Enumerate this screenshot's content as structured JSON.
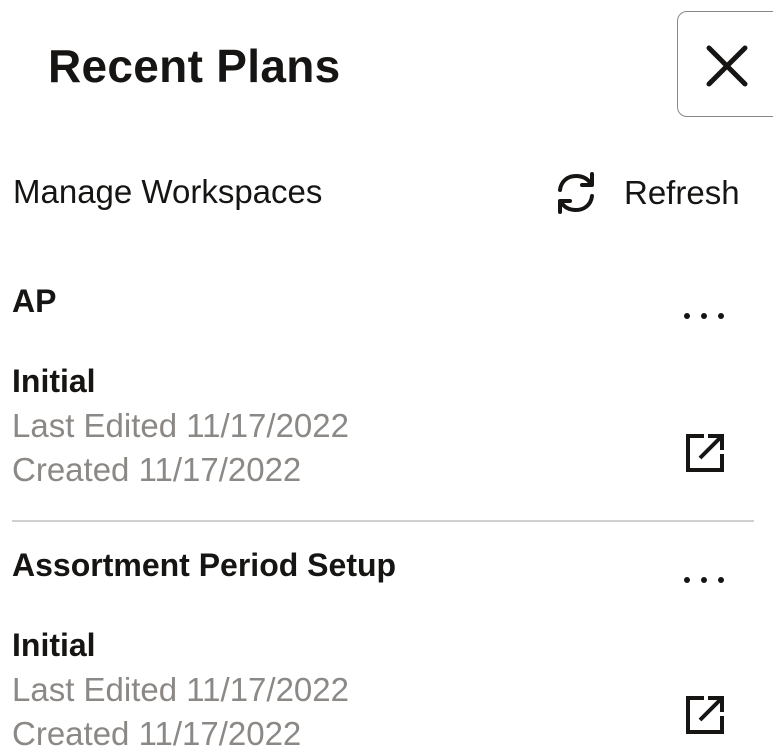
{
  "panel": {
    "title": "Recent Plans",
    "close_icon": "close-icon"
  },
  "toolbar": {
    "manage_label": "Manage Workspaces",
    "refresh_label": "Refresh",
    "refresh_icon": "refresh-icon"
  },
  "plans": [
    {
      "name": "AP",
      "workspace": "Initial",
      "last_edited": "Last Edited 11/17/2022",
      "created": "Created 11/17/2022",
      "more_icon": "more-options-icon",
      "open_icon": "open-external-icon"
    },
    {
      "name": "Assortment Period Setup",
      "workspace": "Initial",
      "last_edited": "Last Edited 11/17/2022",
      "created": "Created 11/17/2022",
      "more_icon": "more-options-icon",
      "open_icon": "open-external-icon"
    }
  ],
  "colors": {
    "text": "#161513",
    "secondary_text": "#8b8885",
    "divider": "#d2d0ce",
    "border": "#8b8885"
  }
}
